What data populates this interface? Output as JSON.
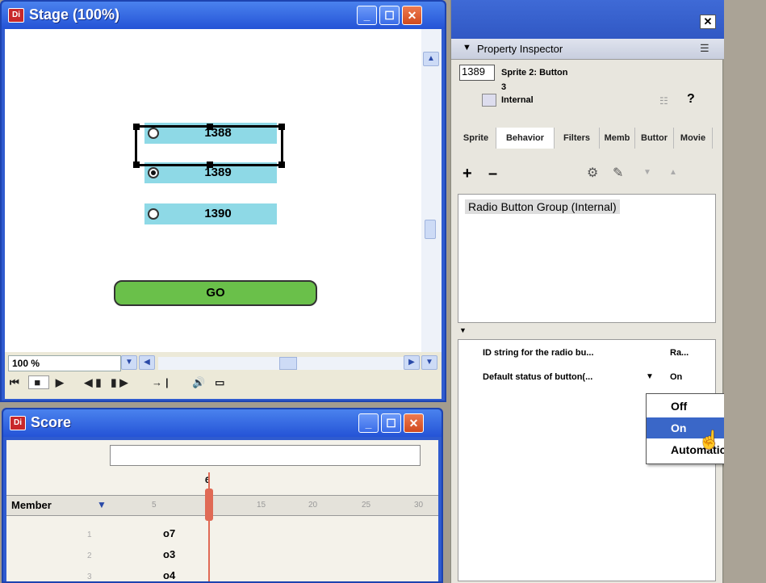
{
  "stage": {
    "title": "Stage (100%)",
    "app_icon": "Di",
    "buttons": [
      {
        "label": "1388",
        "selected": false
      },
      {
        "label": "1389",
        "selected": true
      },
      {
        "label": "1390",
        "selected": false
      }
    ],
    "go_label": "GO",
    "zoom": "100 %"
  },
  "score": {
    "title": "Score",
    "app_icon": "Di",
    "member_label": "Member",
    "playhead_frame": "6",
    "ruler": [
      "5",
      "15",
      "20",
      "25",
      "30"
    ],
    "channels": [
      "1",
      "2",
      "3"
    ],
    "cells": [
      "o7",
      "o3",
      "o4"
    ]
  },
  "inspector": {
    "title": "Property Inspector",
    "member_number": "1389",
    "sprite_line": "Sprite 2: Button",
    "channel_line": "3",
    "cast_line": "Internal",
    "tabs": [
      "Sprite",
      "Behavior",
      "Filters",
      "Memb",
      "Buttor",
      "Movie"
    ],
    "behavior": "Radio Button Group (Internal)",
    "params": [
      {
        "name": "ID string for the radio bu...",
        "value": "Ra..."
      },
      {
        "name": "Default status of button(...",
        "value": "On"
      }
    ]
  },
  "dropdown": {
    "options": [
      "Off",
      "On",
      "Automatic"
    ],
    "highlighted": "On"
  },
  "colors": {
    "titlebar": "#2f5bcf",
    "button_fill": "#8ed9e6",
    "go_fill": "#6ac04a",
    "menu_highlight": "#3a67c8"
  }
}
